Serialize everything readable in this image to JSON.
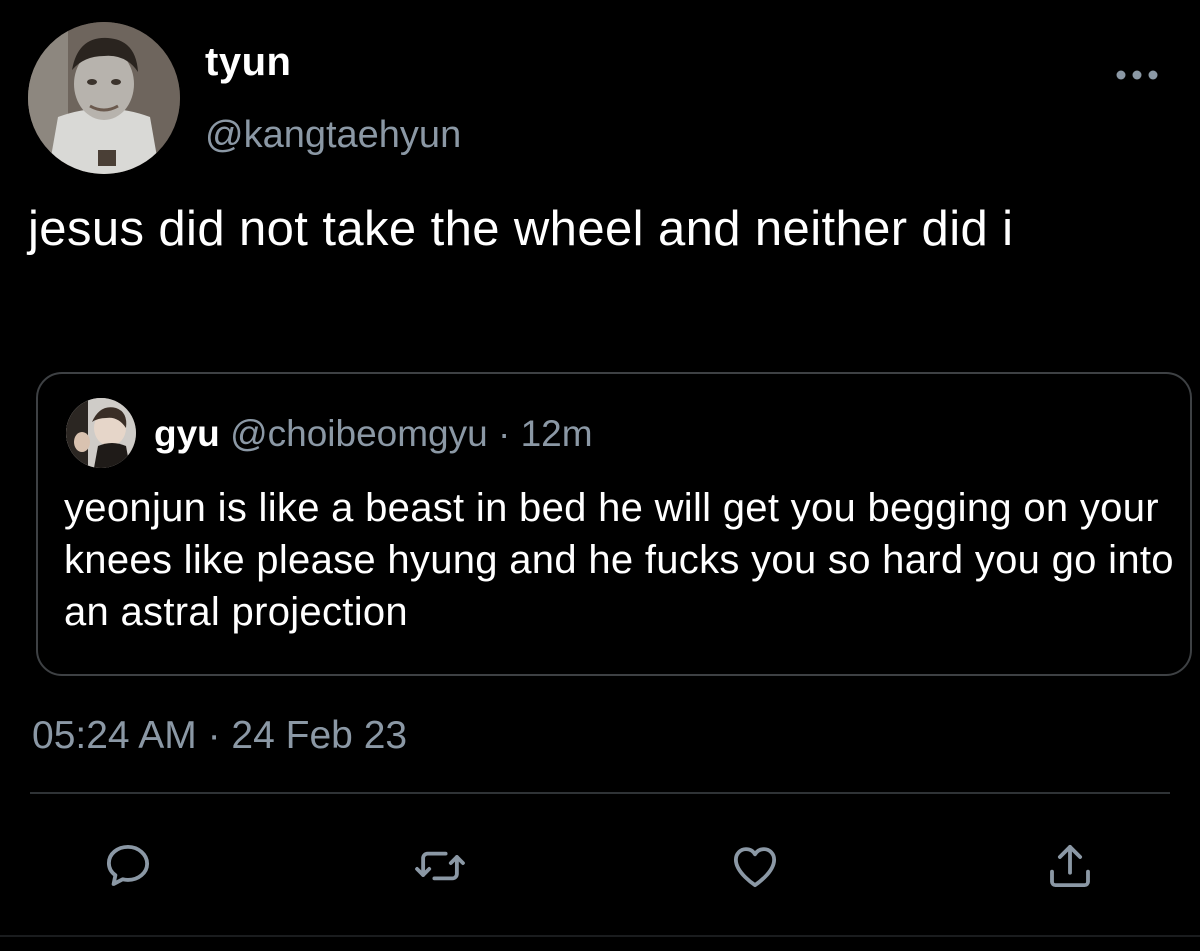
{
  "tweet": {
    "author": {
      "display_name": "tyun",
      "handle": "@kangtaehyun"
    },
    "text": "jesus did not take the wheel and neither did i",
    "timestamp": "05:24 AM · 24 Feb 23"
  },
  "quoted_tweet": {
    "author": {
      "display_name": "gyu",
      "handle": "@choibeomgyu",
      "separator": "·",
      "time_ago": "12m"
    },
    "text": "yeonjun is like a beast in bed he will get you begging on your knees like please hyung and he fucks you so hard you go into an astral projection"
  },
  "actions": [
    {
      "icon": "reply-icon"
    },
    {
      "icon": "retweet-icon"
    },
    {
      "icon": "like-icon"
    },
    {
      "icon": "share-icon"
    }
  ],
  "colors": {
    "background": "#000000",
    "text": "#ffffff",
    "secondary_text": "#8b98a5",
    "border": "#3e4144",
    "divider": "#2f3336"
  }
}
